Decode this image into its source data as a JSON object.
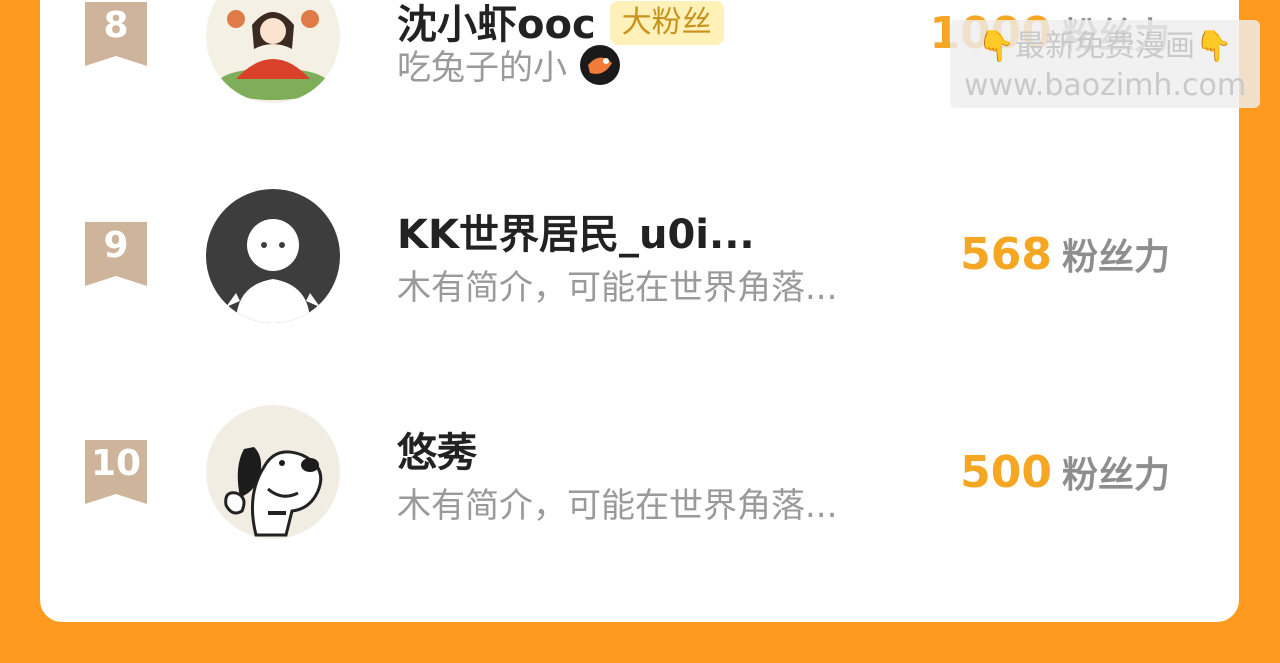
{
  "score_unit": "粉丝力",
  "rows": [
    {
      "rank": "8",
      "name": "沈小虾ooc",
      "tag": "大粉丝",
      "bio": "吃兔子的小",
      "score": "1000"
    },
    {
      "rank": "9",
      "name": "KK世界居民_u0i...",
      "bio": "木有简介，可能在世界角落...",
      "score": "568"
    },
    {
      "rank": "10",
      "name": "悠莠",
      "bio": "木有简介，可能在世界角落...",
      "score": "500"
    }
  ],
  "watermark": {
    "line1_hand_left": "👇",
    "line1_text": "最新免费漫画",
    "line1_hand_right": "👇",
    "line2": "www.baozimh.com"
  },
  "colors": {
    "background": "#ff9a21",
    "card": "#ffffff",
    "score": "#f5a623",
    "rank_badge": "#cdb49a",
    "fan_tag_bg": "#fff1b8"
  }
}
